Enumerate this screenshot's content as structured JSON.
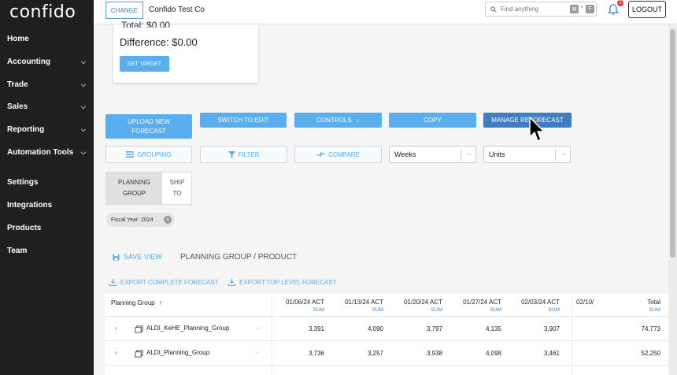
{
  "brand": "confido",
  "sidebar": {
    "items": [
      {
        "label": "Home",
        "chevron": false
      },
      {
        "label": "Accounting",
        "chevron": true
      },
      {
        "label": "Trade",
        "chevron": true
      },
      {
        "label": "Sales",
        "chevron": true
      },
      {
        "label": "Reporting",
        "chevron": true
      },
      {
        "label": "Automation Tools",
        "chevron": true
      },
      {
        "label": "Settings",
        "chevron": false
      },
      {
        "label": "Integrations",
        "chevron": false
      },
      {
        "label": "Products",
        "chevron": false
      },
      {
        "label": "Team",
        "chevron": false
      }
    ]
  },
  "topbar": {
    "change_label": "CHANGE",
    "company": "Confido Test Co",
    "search_placeholder": "Find anything",
    "kbd_a": "⌘",
    "kbd_plus": "+",
    "kbd_b": "F",
    "notification_count": "2",
    "logout_label": "LOGOUT"
  },
  "target_card": {
    "total_text": "Total: $0.00",
    "difference_text": "Difference: $0.00",
    "set_target_label": "SET TARGET"
  },
  "actions": {
    "upload_line1": "UPLOAD NEW",
    "upload_line2": "FORECAST",
    "switch_label": "SWITCH TO EDIT",
    "controls_label": "CONTROLS",
    "copy_label": "COPY",
    "manage_label": "MANAGE REFORECAST",
    "grouping_label": "GROUPING",
    "filter_label": "FILTER",
    "compare_label": "COMPARE",
    "period_value": "Weeks",
    "measure_value": "Units"
  },
  "toggle": {
    "a_line1": "PLANNING",
    "a_line2": "GROUP",
    "b_line1": "SHIP",
    "b_line2": "TO"
  },
  "filter_chip": "Fiscal Year: 2024",
  "save_view_label": "SAVE VIEW",
  "breadcrumb": "PLANNING GROUP / PRODUCT",
  "exports": {
    "complete": "EXPORT COMPLETE FORECAST",
    "top_level": "EXPORT TOP LEVEL FORECAST"
  },
  "table": {
    "group_header": "Planning Group",
    "sort_icon": "↑",
    "sum_label": "SUM",
    "columns": [
      "01/06/24 ACT",
      "01/13/24 ACT",
      "01/20/24 ACT",
      "01/27/24 ACT",
      "02/03/24 ACT",
      "02/10/"
    ],
    "total_header": "Total",
    "rows": [
      {
        "name": "ALDI_KeHE_Planning_Group",
        "values": [
          "3,391",
          "4,090",
          "3,797",
          "4,135",
          "3,907"
        ],
        "total": "74,773"
      },
      {
        "name": "ALDI_Planning_Group",
        "values": [
          "3,736",
          "3,257",
          "3,938",
          "4,098",
          "3,461"
        ],
        "total": "52,250"
      }
    ]
  },
  "colors": {
    "accent": "#5aaeee",
    "sidebar_bg": "#1f1f1f",
    "manage_btn": "#3f7fc1"
  }
}
